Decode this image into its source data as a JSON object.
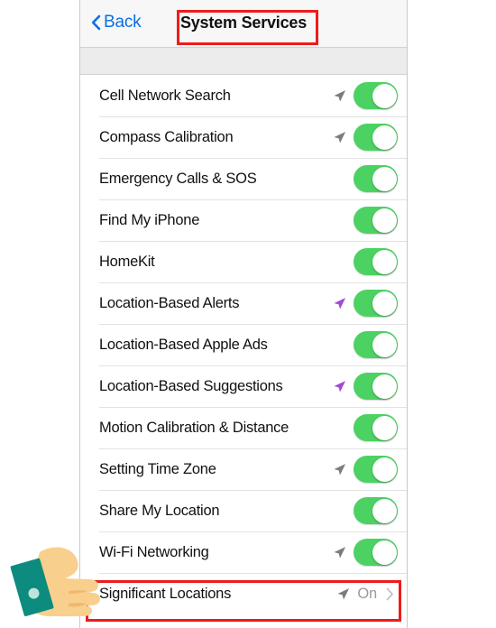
{
  "window": {
    "title": "System Services"
  },
  "navbar": {
    "back_label": "Back",
    "back_icon": "chevron-left-icon",
    "title": "System Services",
    "accent_color": "#0a70e0"
  },
  "colors": {
    "toggle_on": "#4cd263",
    "arrow_gray": "#7b7b80",
    "arrow_purple": "#a249d8",
    "highlight_red": "#ee1b1b",
    "value_gray": "#9a9a9f",
    "page_bg": "#ececed",
    "hand_skin": "#f9cf8e",
    "hand_cuff": "#0d8b7e",
    "hand_button": "#bee3dc"
  },
  "list": {
    "rows": [
      {
        "label": "Cell Network Search",
        "arrow": "gray",
        "control": "toggle",
        "toggle_on": true
      },
      {
        "label": "Compass Calibration",
        "arrow": "gray",
        "control": "toggle",
        "toggle_on": true
      },
      {
        "label": "Emergency Calls & SOS",
        "arrow": "none",
        "control": "toggle",
        "toggle_on": true
      },
      {
        "label": "Find My iPhone",
        "arrow": "none",
        "control": "toggle",
        "toggle_on": true
      },
      {
        "label": "HomeKit",
        "arrow": "none",
        "control": "toggle",
        "toggle_on": true
      },
      {
        "label": "Location-Based Alerts",
        "arrow": "purple",
        "control": "toggle",
        "toggle_on": true
      },
      {
        "label": "Location-Based Apple Ads",
        "arrow": "none",
        "control": "toggle",
        "toggle_on": true
      },
      {
        "label": "Location-Based Suggestions",
        "arrow": "purple",
        "control": "toggle",
        "toggle_on": true
      },
      {
        "label": "Motion Calibration & Distance",
        "arrow": "none",
        "control": "toggle",
        "toggle_on": true
      },
      {
        "label": "Setting Time Zone",
        "arrow": "gray",
        "control": "toggle",
        "toggle_on": true
      },
      {
        "label": "Share My Location",
        "arrow": "none",
        "control": "toggle",
        "toggle_on": true
      },
      {
        "label": "Wi-Fi Networking",
        "arrow": "gray",
        "control": "toggle",
        "toggle_on": true
      },
      {
        "label": "Significant Locations",
        "arrow": "gray",
        "control": "disclosure",
        "value": "On"
      }
    ]
  },
  "annotations": {
    "title_highlight": "System Services",
    "row_highlight": "Significant Locations",
    "pointer": "pointing-hand-cursor"
  }
}
